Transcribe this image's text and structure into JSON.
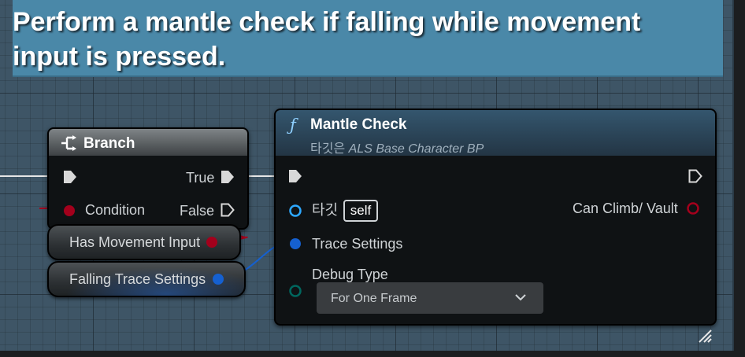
{
  "comment": {
    "text": "Perform a mantle check if falling while movement input is pressed."
  },
  "branch": {
    "title": "Branch",
    "pins": {
      "true_label": "True",
      "condition_label": "Condition",
      "false_label": "False"
    }
  },
  "variables": {
    "has_movement_input": "Has Movement Input",
    "falling_trace_settings": "Falling Trace Settings"
  },
  "mantle_check": {
    "title": "Mantle Check",
    "subtitle_prefix": "타깃은",
    "subtitle_target": "ALS Base Character BP",
    "function_glyph": "ƒ",
    "pins": {
      "target_label": "타깃",
      "target_default": "self",
      "trace_settings_label": "Trace Settings",
      "debug_type_label": "Debug Type",
      "debug_type_value": "For One Frame",
      "output_label": "Can Climb/ Vault"
    }
  },
  "colors": {
    "comment_title_bg": "#4a88a8",
    "bool_pin": "#a3001c",
    "struct_pin": "#0058c7",
    "enum_pin": "#00665e",
    "exec_pin": "#ffffff",
    "object_pin": "#2da8ff"
  },
  "icons": {
    "branch": "branch-icon",
    "function": "function-icon",
    "dropdown": "chevron-down-icon",
    "resize": "resize-grip-icon"
  }
}
